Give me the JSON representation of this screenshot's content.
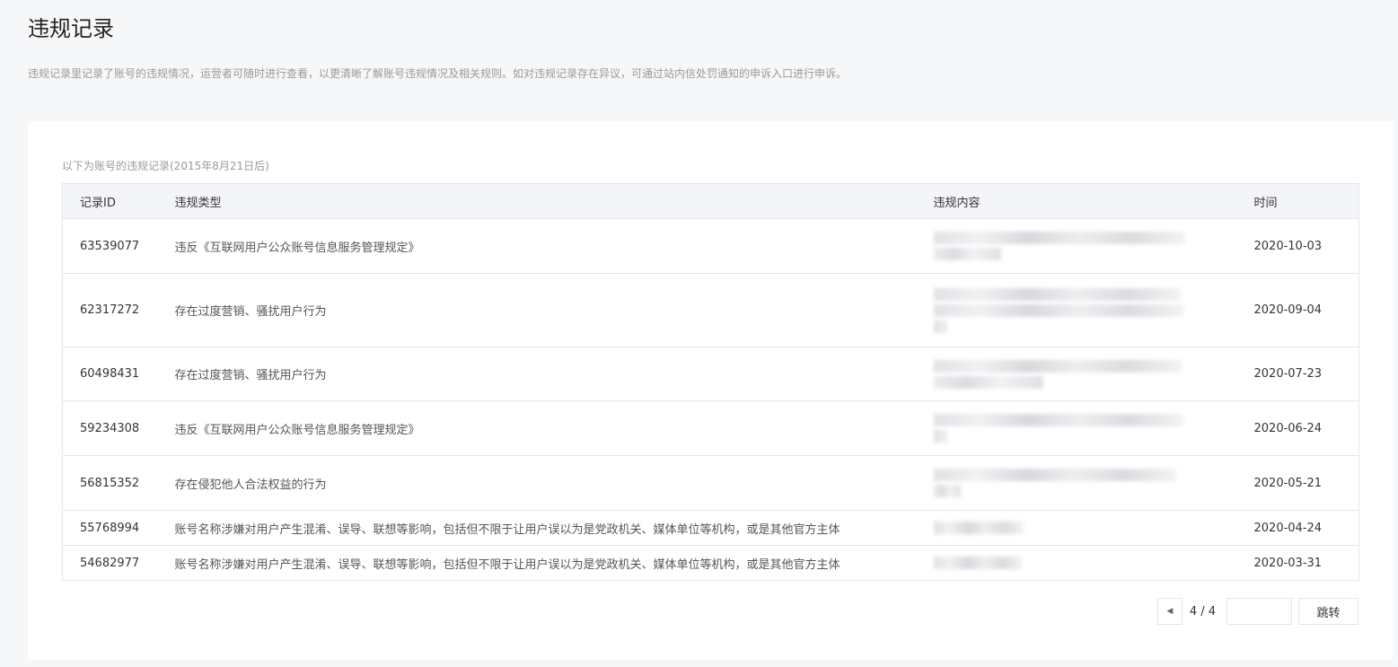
{
  "page": {
    "title": "违规记录",
    "description": "违规记录里记录了账号的违规情况，运营者可随时进行查看，以更清晰了解账号违规情况及相关规则。如对违规记录存在异议，可通过站内信处罚通知的申诉入口进行申诉。"
  },
  "table": {
    "caption": "以下为账号的违规记录(2015年8月21日后)",
    "headers": {
      "id": "记录ID",
      "type": "违规类型",
      "content": "违规内容",
      "time": "时间"
    },
    "rows": [
      {
        "id": "63539077",
        "type": "违反《互联网用户公众账号信息服务管理规定》",
        "time": "2020-10-03"
      },
      {
        "id": "62317272",
        "type": "存在过度营销、骚扰用户行为",
        "time": "2020-09-04"
      },
      {
        "id": "60498431",
        "type": "存在过度营销、骚扰用户行为",
        "time": "2020-07-23"
      },
      {
        "id": "59234308",
        "type": "违反《互联网用户公众账号信息服务管理规定》",
        "time": "2020-06-24"
      },
      {
        "id": "56815352",
        "type": "存在侵犯他人合法权益的行为",
        "time": "2020-05-21"
      },
      {
        "id": "55768994",
        "type": "账号名称涉嫌对用户产生混淆、误导、联想等影响，包括但不限于让用户误以为是党政机关、媒体单位等机构，或是其他官方主体",
        "time": "2020-04-24"
      },
      {
        "id": "54682977",
        "type": "账号名称涉嫌对用户产生混淆、误导、联想等影响，包括但不限于让用户误以为是党政机关、媒体单位等机构，或是其他官方主体",
        "time": "2020-03-31"
      }
    ]
  },
  "pager": {
    "prev_icon": "caret-left-icon",
    "page_info": "4 / 4",
    "input_value": "",
    "jump_label": "跳转"
  }
}
